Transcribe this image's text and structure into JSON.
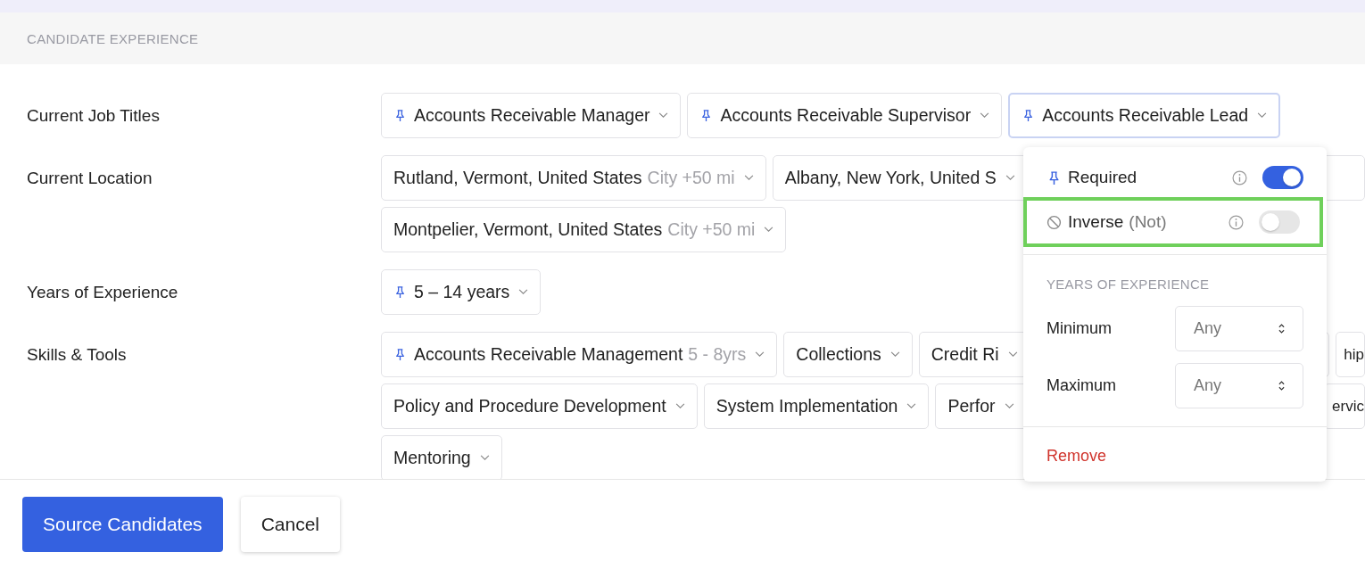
{
  "section": {
    "title": "CANDIDATE EXPERIENCE"
  },
  "fields": [
    {
      "label": "Current Job Titles",
      "rows": [
        [
          {
            "text": "Accounts Receivable Manager",
            "pinned": true,
            "kind": "full",
            "selected": false
          },
          {
            "text": "Accounts Receivable Supervisor",
            "pinned": true,
            "kind": "full",
            "selected": false
          },
          {
            "text": "Accounts Receivable Lead",
            "pinned": true,
            "kind": "full",
            "selected": true
          }
        ]
      ]
    },
    {
      "label": "Current Location",
      "rows": [
        [
          {
            "text": "Rutland, Vermont, United States",
            "note": "City +50 mi",
            "pinned": false,
            "kind": "full"
          },
          {
            "text": "Albany, New York, United S",
            "pinned": false,
            "kind": "cut"
          }
        ],
        [
          {
            "text": "Montpelier, Vermont, United States",
            "note": "City +50 mi",
            "pinned": false,
            "kind": "full"
          }
        ]
      ]
    },
    {
      "label": "Years of Experience",
      "rows": [
        [
          {
            "text": "5 – 14 years",
            "pinned": true,
            "kind": "full"
          }
        ]
      ]
    },
    {
      "label": "Skills & Tools",
      "rows": [
        [
          {
            "text": "Accounts Receivable Management",
            "note": "5 - 8yrs",
            "pinned": true,
            "kind": "full"
          },
          {
            "text": "Collections",
            "pinned": false,
            "kind": "full"
          },
          {
            "text": "Credit Ri",
            "pinned": false,
            "kind": "cut"
          },
          {
            "text": "hip",
            "pinned": false,
            "kind": "tail"
          }
        ],
        [
          {
            "text": "Policy and Procedure Development",
            "pinned": false,
            "kind": "full"
          },
          {
            "text": "System Implementation",
            "pinned": false,
            "kind": "full"
          },
          {
            "text": "Perfor",
            "pinned": false,
            "kind": "cut"
          },
          {
            "text": "ervic",
            "pinned": false,
            "kind": "tail"
          }
        ],
        [
          {
            "text": "Mentoring",
            "pinned": false,
            "kind": "full"
          }
        ]
      ]
    }
  ],
  "popover": {
    "toggles": [
      {
        "kind": "pin",
        "label": "Required",
        "on": true,
        "highlighted": false
      },
      {
        "kind": "ban",
        "label": "Inverse",
        "note": "(Not)",
        "on": false,
        "highlighted": true
      }
    ],
    "heading": "YEARS OF EXPERIENCE",
    "selects": [
      {
        "label": "Minimum",
        "value": "Any"
      },
      {
        "label": "Maximum",
        "value": "Any"
      }
    ],
    "remove": "Remove"
  },
  "buttons": [
    {
      "label": "Source Candidates",
      "kind": "primary"
    },
    {
      "label": "Cancel",
      "kind": "secondary"
    }
  ]
}
